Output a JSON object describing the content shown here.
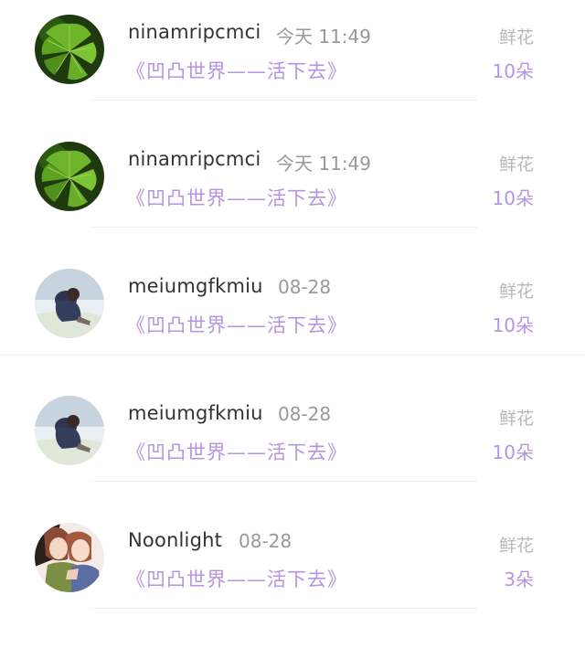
{
  "records": [
    {
      "user": "ninamripcmci",
      "time": "今天 11:49",
      "book": "《凹凸世界——活下去》",
      "gift_type": "鲜花",
      "gift_count": "10朵",
      "avatar": "ginkgo-leaf-avatar"
    },
    {
      "user": "ninamripcmci",
      "time": "今天 11:49",
      "book": "《凹凸世界——活下去》",
      "gift_type": "鲜花",
      "gift_count": "10朵",
      "avatar": "ginkgo-leaf-avatar"
    },
    {
      "user": "meiumgfkmiu",
      "time": "08-28",
      "book": "《凹凸世界——活下去》",
      "gift_type": "鲜花",
      "gift_count": "10朵",
      "avatar": "sitting-figure-avatar"
    },
    {
      "user": "meiumgfkmiu",
      "time": "08-28",
      "book": "《凹凸世界——活下去》",
      "gift_type": "鲜花",
      "gift_count": "10朵",
      "avatar": "sitting-figure-avatar"
    },
    {
      "user": "Noonlight",
      "time": "08-28",
      "book": "《凹凸世界——活下去》",
      "gift_type": "鲜花",
      "gift_count": "3朵",
      "avatar": "anime-girls-avatar"
    }
  ],
  "colors": {
    "accent_purple": "#b694e0",
    "username": "#333333",
    "muted": "#999999",
    "divider": "#f0f0f0"
  }
}
